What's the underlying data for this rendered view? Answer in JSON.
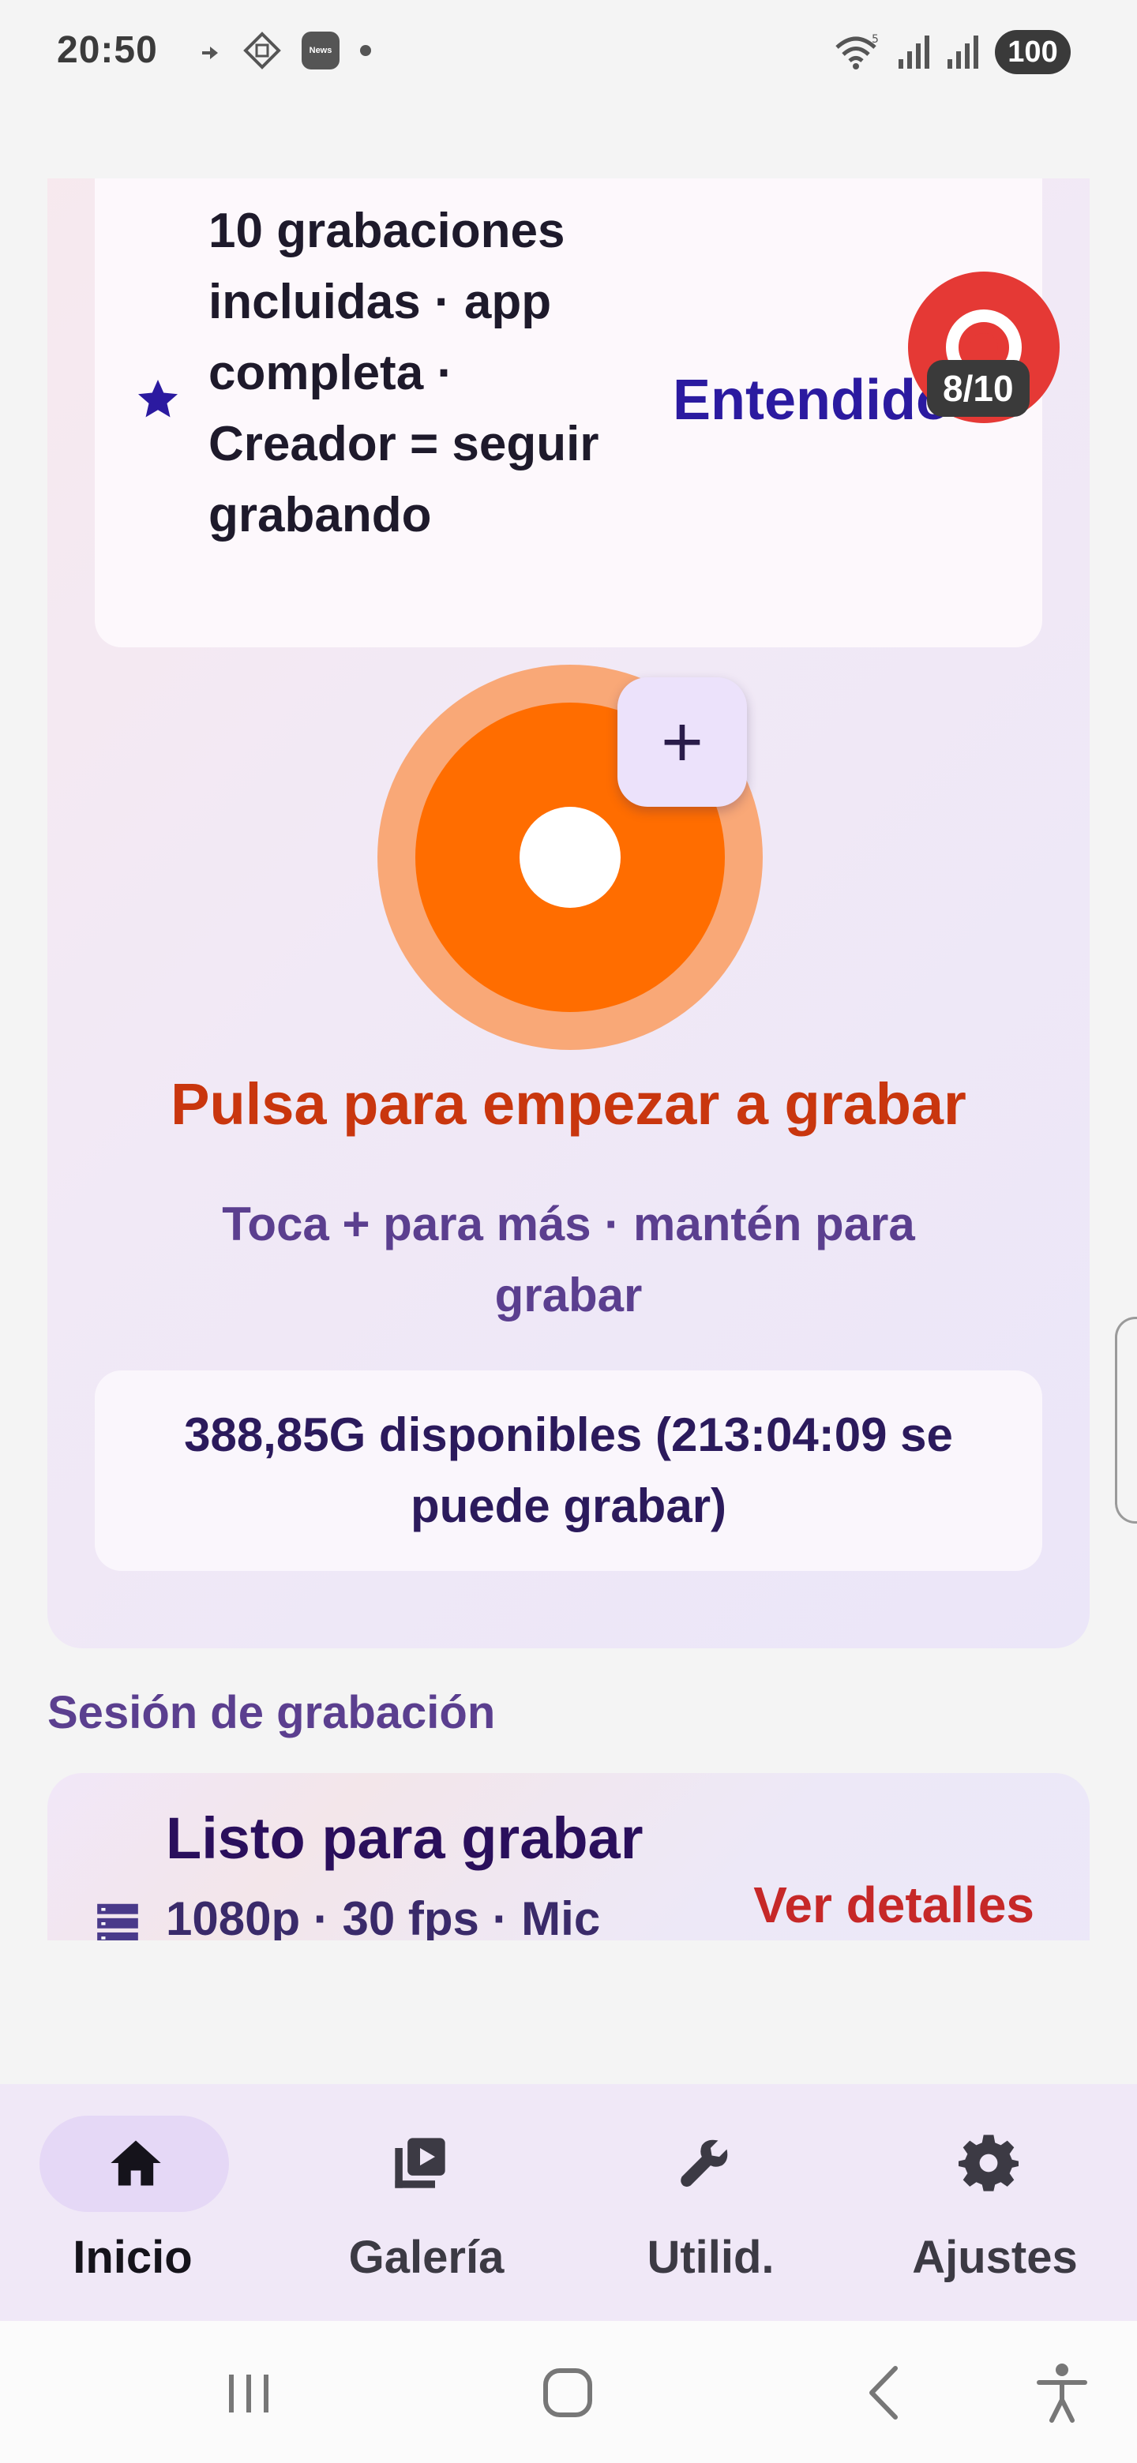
{
  "status_bar": {
    "time": "20:50",
    "news_badge": "News",
    "battery": "100",
    "icons": [
      "wifi-icon",
      "signal-icon",
      "signal-icon"
    ]
  },
  "info_card": {
    "text": "10 grabaciones incluidas · app completa · Creador = seguir grabando",
    "action": "Entendido",
    "icon": "star-icon"
  },
  "overlay": {
    "counter": "8/10",
    "icon": "record-overlay-icon"
  },
  "recorder": {
    "add_label": "+",
    "title": "Pulsa para empezar a grabar",
    "hint": "Toca + para más · mantén para grabar",
    "storage": "388,85G disponibles (213:04:09 se puede grabar)"
  },
  "session": {
    "section_title": "Sesión de grabación",
    "title": "Listo para grabar",
    "subtitle": "1080p · 30 fps · Mic",
    "details": "Ver detalles"
  },
  "nav": {
    "items": [
      {
        "label": "Inicio",
        "icon": "home-icon",
        "active": true
      },
      {
        "label": "Galería",
        "icon": "gallery-icon",
        "active": false
      },
      {
        "label": "Utilid.",
        "icon": "wrench-icon",
        "active": false
      },
      {
        "label": "Ajustes",
        "icon": "gear-icon",
        "active": false
      }
    ]
  },
  "colors": {
    "record_orange": "#ff6d00",
    "record_halo": "#f9a877",
    "title_red": "#c9360e",
    "accent_purple": "#5b3f8f",
    "action_blue": "#2b1aa0",
    "overlay_red": "#e53935"
  }
}
